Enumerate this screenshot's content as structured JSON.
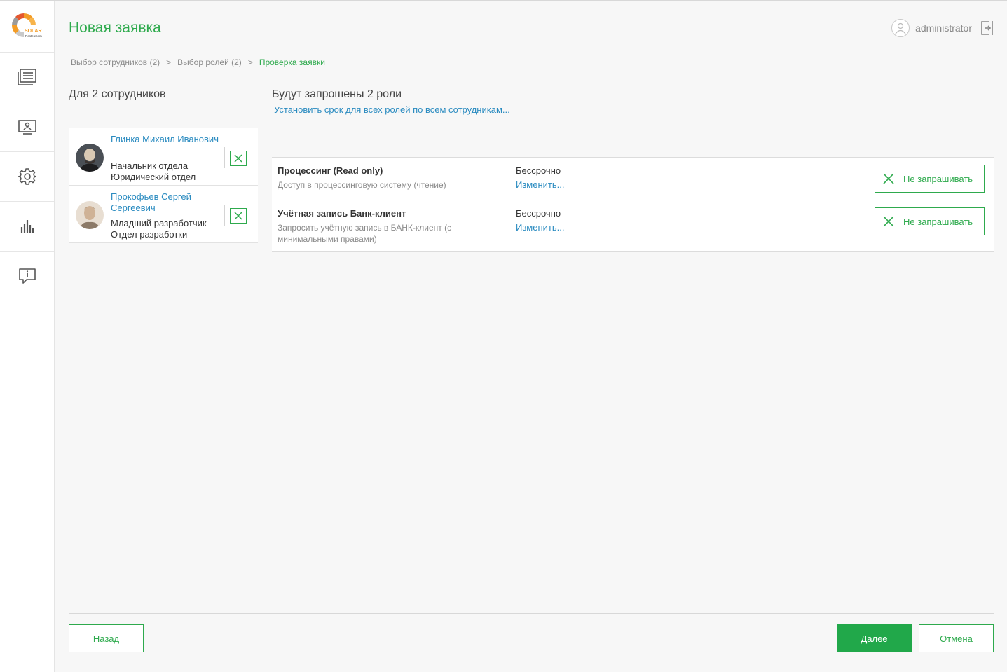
{
  "app": {
    "logo_text": "SOLAR",
    "logo_subtext": "Rostelecom"
  },
  "header": {
    "title": "Новая заявка",
    "username": "administrator"
  },
  "breadcrumb": {
    "step1": "Выбор сотрудников (2)",
    "step2": "Выбор ролей (2)",
    "step3": "Проверка заявки",
    "separator": ">"
  },
  "employees": {
    "heading": "Для 2 сотрудников",
    "items": [
      {
        "name": "Глинка Михаил Иванович",
        "position": "Начальник отдела",
        "department": "Юридический отдел"
      },
      {
        "name": "Прокофьев Сергей Сергеевич",
        "position": "Младший разработчик",
        "department": "Отдел разработки"
      }
    ]
  },
  "roles": {
    "heading": "Будут запрошены 2 роли",
    "set_term_link": "Установить срок для всех ролей по всем сотрудникам...",
    "items": [
      {
        "name": "Процессинг (Read only)",
        "description": "Доступ в процессинговую систему (чтение)",
        "term": "Бессрочно",
        "change_label": "Изменить...",
        "action_label": "Не запрашивать"
      },
      {
        "name": "Учётная запись Банк-клиент",
        "description": "Запросить учётную запись в БАНК-клиент (с минимальными правами)",
        "term": "Бессрочно",
        "change_label": "Изменить...",
        "action_label": "Не запрашивать"
      }
    ]
  },
  "footer": {
    "back_label": "Назад",
    "next_label": "Далее",
    "cancel_label": "Отмена"
  },
  "colors": {
    "accent_green": "#2eaa4d",
    "link_blue": "#2a8bc0",
    "primary_button": "#21a84a"
  },
  "sidebar": {
    "icons": [
      "requests-icon",
      "monitor-icon",
      "gear-icon",
      "chart-icon",
      "info-message-icon"
    ]
  }
}
